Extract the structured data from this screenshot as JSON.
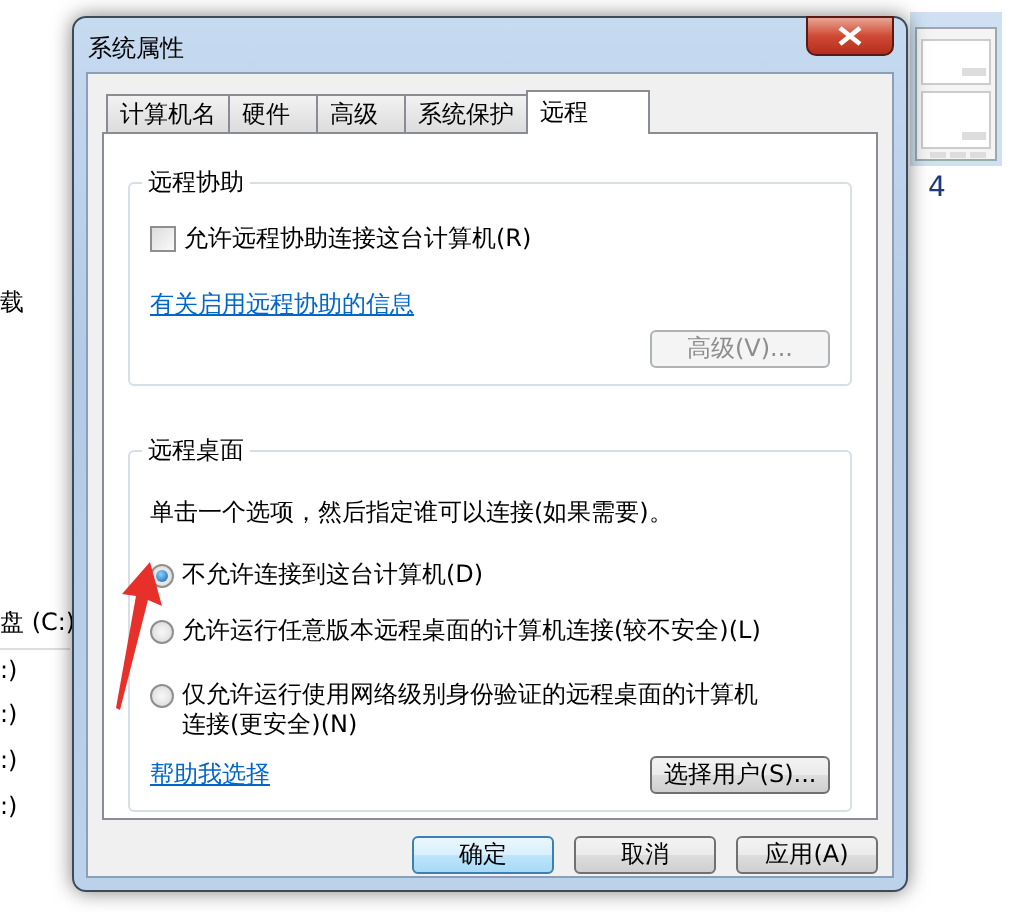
{
  "background": {
    "left_texts": [
      "载",
      "盘 (C:)",
      ":)",
      ":)",
      ":)",
      ":)"
    ],
    "right_text": "4"
  },
  "window": {
    "title": "系统属性"
  },
  "tabs": [
    {
      "label": "计算机名",
      "selected": false
    },
    {
      "label": "硬件",
      "selected": false
    },
    {
      "label": "高级",
      "selected": false
    },
    {
      "label": "系统保护",
      "selected": false
    },
    {
      "label": "远程",
      "selected": true
    }
  ],
  "remote_assistance": {
    "title": "远程协助",
    "allow": {
      "label": "允许远程协助连接这台计算机(R)",
      "checked": false
    },
    "link": "有关启用远程协助的信息",
    "advanced_button": {
      "label": "高级(V)...",
      "disabled": true
    }
  },
  "remote_desktop": {
    "title": "远程桌面",
    "instruction": "单击一个选项，然后指定谁可以连接(如果需要)。",
    "options": [
      {
        "label": "不允许连接到这台计算机(D)",
        "selected": true
      },
      {
        "label": "允许运行任意版本远程桌面的计算机连接(较不安全)(L)",
        "selected": false
      },
      {
        "label": "仅允许运行使用网络级别身份验证的远程桌面的计算机连接(更安全)(N)",
        "selected": false
      }
    ],
    "help_link": "帮助我选择",
    "select_users_button": "选择用户(S)..."
  },
  "buttons": [
    {
      "label": "确定",
      "default": true
    },
    {
      "label": "取消",
      "default": false
    },
    {
      "label": "应用(A)",
      "default": false
    }
  ]
}
